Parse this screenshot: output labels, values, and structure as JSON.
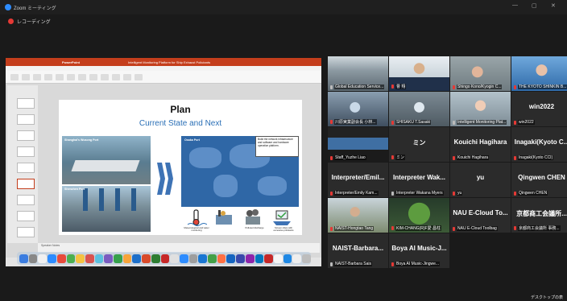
{
  "window": {
    "title": "Zoom ミーティング",
    "controls": [
      "—",
      "▢",
      "✕"
    ]
  },
  "recording": {
    "label": "レコーディング"
  },
  "presentation": {
    "title": "Plan",
    "subtitle": "Current State and Next",
    "left_photo_top_label": "Shanghai's Wusong Port",
    "left_photo_bottom_label": "Shenzhen Port",
    "map_label": "Osaka Port",
    "map_note": "Build the network infrastructure and software and hardware operation platform.",
    "icon_labels": [
      "Meteorological and water monitoring",
      "",
      "Polluted discharge",
      "Screen ships with excessive pollutants"
    ],
    "file_title": "Intelligent Monitoring Platform for Ship Exhaust Pollutants",
    "app_name": "PowerPoint",
    "notes_label": "Speaker Notes"
  },
  "gallery": [
    {
      "label": "Global Education Service...",
      "name": "",
      "video": "classroom",
      "mic_muted": false
    },
    {
      "label": "曹 翔",
      "name": "",
      "video": "man-suit",
      "mic_muted": true
    },
    {
      "label": "Shingo Kono/Kyogin C...",
      "name": "",
      "video": "woman-office",
      "mic_muted": true
    },
    {
      "label": "THE KYOTO SHINKIN B...",
      "name": "",
      "video": "woman-blue",
      "mic_muted": true
    },
    {
      "label": "川原実業副会長 小林...",
      "name": "",
      "video": "man-mask",
      "mic_muted": true
    },
    {
      "label": "SHISAKU T.Sasaki",
      "name": "",
      "video": "man-mask2",
      "mic_muted": true
    },
    {
      "label": "Intelligent Monitoring Plat...",
      "name": "",
      "video": "woman-presenter",
      "mic_muted": false
    },
    {
      "label": "win2022",
      "name": "win2022",
      "video": "",
      "mic_muted": true
    },
    {
      "label": "Staff_Yuzhe Liao",
      "name": "",
      "video": "desk",
      "mic_muted": true
    },
    {
      "label": "ミン",
      "name": "ミン",
      "video": "",
      "mic_muted": true
    },
    {
      "label": "Kouichi Hagihara",
      "name": "Kouichi Hagihara",
      "video": "",
      "mic_muted": true
    },
    {
      "label": "Inagaki(Kyoto CCI)",
      "name": "Inagaki(Kyoto C...",
      "video": "",
      "mic_muted": true
    },
    {
      "label": "Interpreter/Emily Kam...",
      "name": "Interpreter/Emil...",
      "video": "",
      "mic_muted": true
    },
    {
      "label": "Interpreter Wakana Myers",
      "name": "Interpreter Wak...",
      "video": "",
      "mic_muted": false
    },
    {
      "label": "yu",
      "name": "yu",
      "video": "",
      "mic_muted": true
    },
    {
      "label": "Qingwen CHEN",
      "name": "Qingwen CHEN",
      "video": "",
      "mic_muted": true
    },
    {
      "label": "NAIST-Hongtao Tang",
      "name": "",
      "video": "outdoor",
      "mic_muted": true
    },
    {
      "label": "KIM-CHANG(R)F愛 昌柱",
      "name": "",
      "video": "tree",
      "mic_muted": true
    },
    {
      "label": "NAU E-Cloud Toolbag",
      "name": "NAU E-Cloud To...",
      "video": "",
      "mic_muted": true
    },
    {
      "label": "京都商工会議所 事務...",
      "name": "京都商工会議所...",
      "video": "",
      "mic_muted": true
    },
    {
      "label": "NAIST-Barbara Sais",
      "name": "NAIST-Barbara...",
      "video": "",
      "mic_muted": false
    },
    {
      "label": "Boya AI Music-Jingwe...",
      "name": "Boya AI Music-J...",
      "video": "",
      "mic_muted": true
    }
  ],
  "footer": {
    "desktop_label": "デスクトップの表"
  }
}
